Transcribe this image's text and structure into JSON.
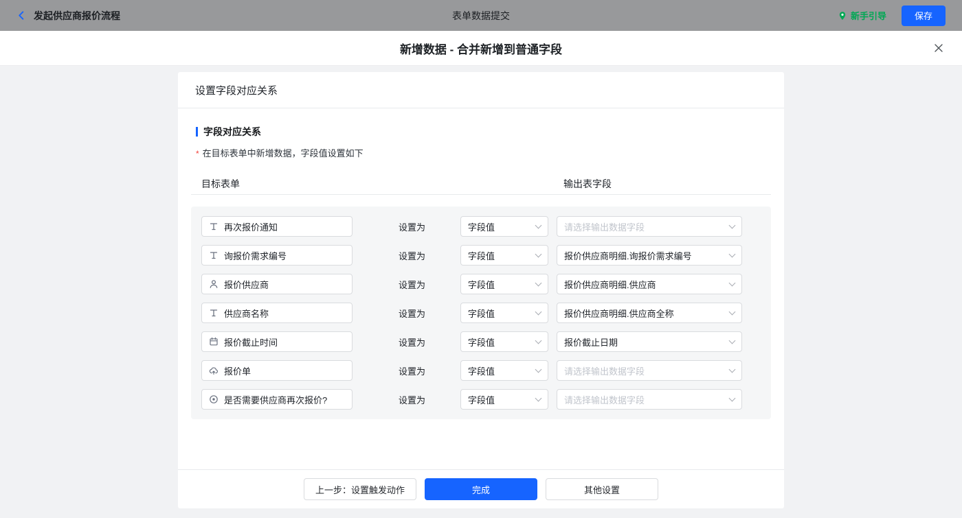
{
  "topbar": {
    "back_label": "发起供应商报价流程",
    "title": "表单数据提交",
    "guide_label": "新手引导",
    "save_label": "保存"
  },
  "header": {
    "title": "新增数据 - 合并新增到普通字段"
  },
  "card": {
    "title": "设置字段对应关系",
    "section_title": "字段对应关系",
    "required_mark": "*",
    "hint": "在目标表单中新增数据，字段值设置如下",
    "col_left": "目标表单",
    "col_right": "输出表字段",
    "set_as": "设置为",
    "rows": [
      {
        "icon": "text-field-icon",
        "field": "再次报价通知",
        "mode": "字段值",
        "output": "请选择输出数据字段",
        "is_placeholder": true
      },
      {
        "icon": "text-field-icon",
        "field": "询报价需求编号",
        "mode": "字段值",
        "output": "报价供应商明细.询报价需求编号",
        "is_placeholder": false
      },
      {
        "icon": "person-icon",
        "field": "报价供应商",
        "mode": "字段值",
        "output": "报价供应商明细.供应商",
        "is_placeholder": false
      },
      {
        "icon": "text-field-icon",
        "field": "供应商名称",
        "mode": "字段值",
        "output": "报价供应商明细.供应商全称",
        "is_placeholder": false
      },
      {
        "icon": "calendar-icon",
        "field": "报价截止时间",
        "mode": "字段值",
        "output": "报价截止日期",
        "is_placeholder": false
      },
      {
        "icon": "cloud-upload-icon",
        "field": "报价单",
        "mode": "字段值",
        "output": "请选择输出数据字段",
        "is_placeholder": true
      },
      {
        "icon": "radio-icon",
        "field": "是否需要供应商再次报价?",
        "mode": "字段值",
        "output": "请选择输出数据字段",
        "is_placeholder": true
      }
    ],
    "footer": {
      "prev_label": "上一步：设置触发动作",
      "done_label": "完成",
      "other_label": "其他设置"
    }
  },
  "colors": {
    "accent_blue": "#1664ff",
    "guide_green": "#00a854",
    "topbar_gray": "#98999b",
    "panel_gray": "#f5f6f7",
    "required_red": "#f2413a"
  }
}
